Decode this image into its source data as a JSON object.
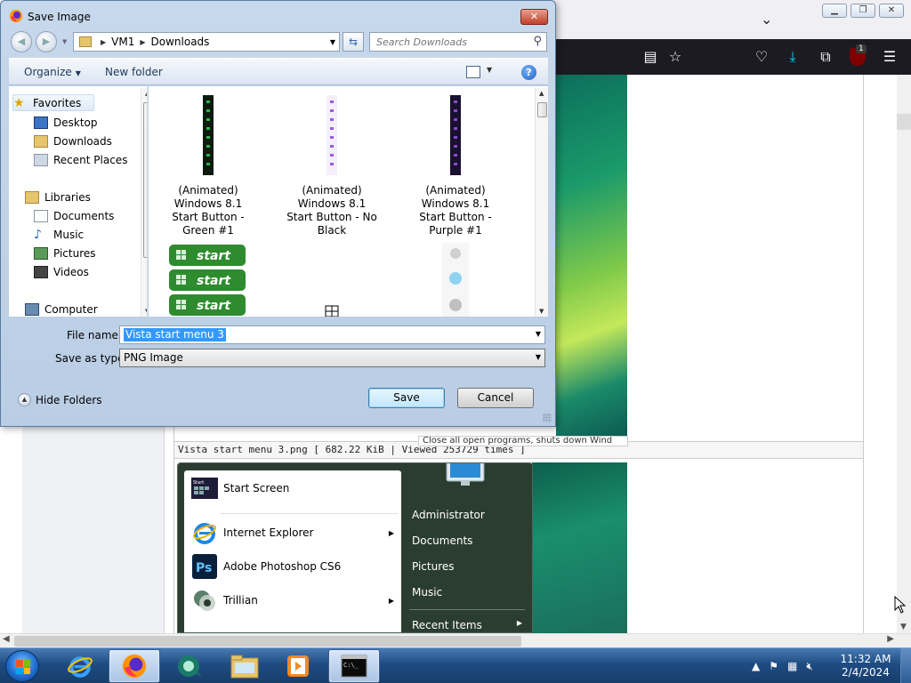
{
  "dialog": {
    "title": "Save Image",
    "close_label": "✕",
    "breadcrumb": [
      "VM1",
      "Downloads"
    ],
    "search_placeholder": "Search Downloads",
    "toolbar": {
      "organize": "Organize",
      "new_folder": "New folder"
    },
    "nav": {
      "favorites": "Favorites",
      "desktop": "Desktop",
      "downloads": "Downloads",
      "recent_places": "Recent Places",
      "libraries": "Libraries",
      "documents": "Documents",
      "music": "Music",
      "pictures": "Pictures",
      "videos": "Videos",
      "computer": "Computer"
    },
    "files": [
      {
        "l1": "(Animated)",
        "l2": "Windows 8.1",
        "l3": "Start Button -",
        "l4": "Green #1",
        "color": "#1e7a32"
      },
      {
        "l1": "(Animated)",
        "l2": "Windows 8.1",
        "l3": "Start Button - No",
        "l4": "Black",
        "color": "#9b59e0"
      },
      {
        "l1": "(Animated)",
        "l2": "Windows 8.1",
        "l3": "Start Button -",
        "l4": "Purple #1",
        "color": "#5b2a8e"
      }
    ],
    "start_button_label": "start",
    "file_name_label": "File name:",
    "file_name_value": "Vista start menu 3",
    "save_type_label": "Save as type:",
    "save_type_value": "PNG Image",
    "hide_folders": "Hide Folders",
    "save": "Save",
    "cancel": "Cancel"
  },
  "browser": {
    "image_caption": "Vista start menu 3.png [ 682.22 KiB | Viewed 253729 times ]",
    "tooltip": "Close all open programs, shuts down Wind",
    "ublock_count": "1",
    "start_menu": {
      "left_items": [
        {
          "label": "Start Screen",
          "icon": "start-screen-icon",
          "arrow": false
        },
        {
          "label": "Internet Explorer",
          "icon": "ie-icon",
          "arrow": true
        },
        {
          "label": "Adobe Photoshop CS6",
          "icon": "photoshop-icon",
          "arrow": false
        },
        {
          "label": "Trillian",
          "icon": "trillian-icon",
          "arrow": true
        }
      ],
      "right_items": [
        "Administrator",
        "Documents",
        "Pictures",
        "Music",
        "Recent Items"
      ],
      "start_tile_label": "Start"
    }
  },
  "taskbar": {
    "time": "11:32 AM",
    "date": "2/4/2024"
  },
  "colors": {
    "accent": "#3399ff",
    "toolbar_dark": "#1c1b22",
    "taskbar": "#1e4c82"
  }
}
